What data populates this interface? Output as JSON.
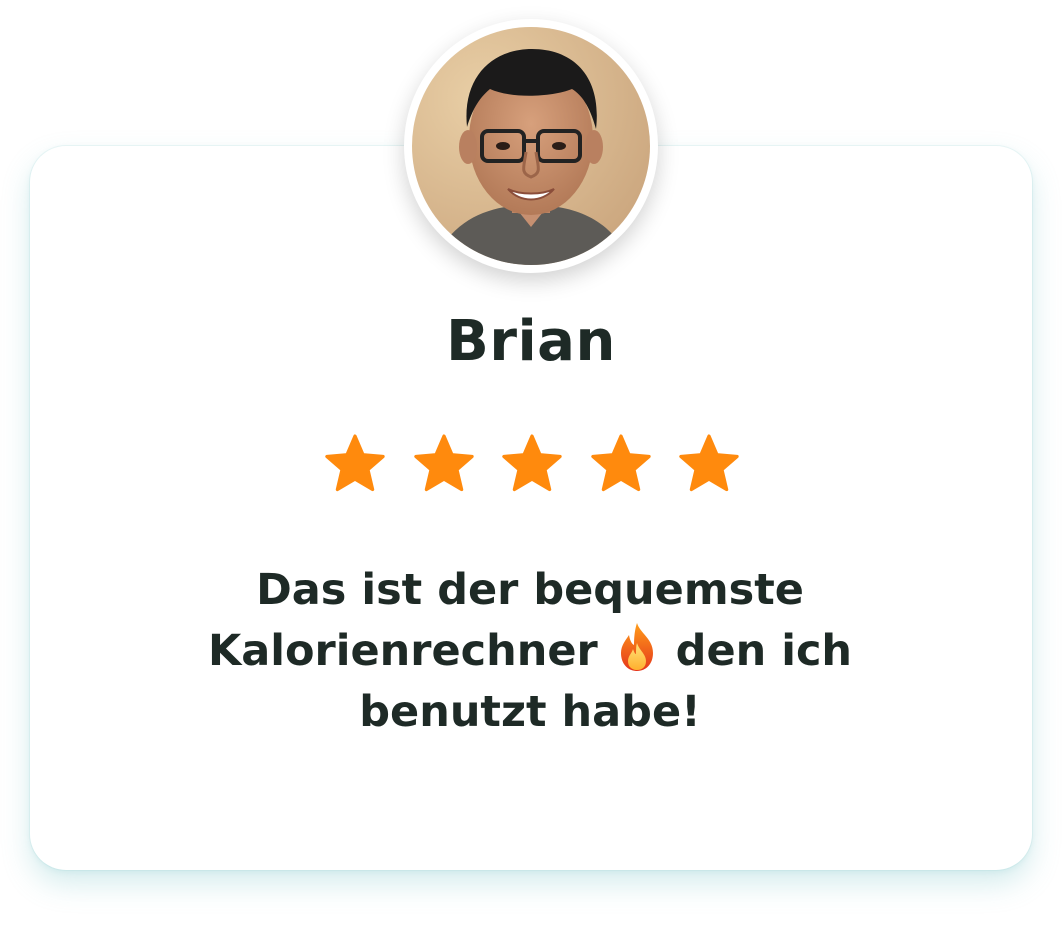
{
  "review": {
    "name": "Brian",
    "rating": 5,
    "max_rating": 5,
    "text_before_icon": "Das ist der bequemste Kalorienrechner ",
    "text_after_icon": " den ich benutzt habe!",
    "icon": "fire-emoji-icon"
  },
  "colors": {
    "star": "#FF8A0D",
    "text": "#1E2A26",
    "card_shadow": "#8FD0D4"
  }
}
